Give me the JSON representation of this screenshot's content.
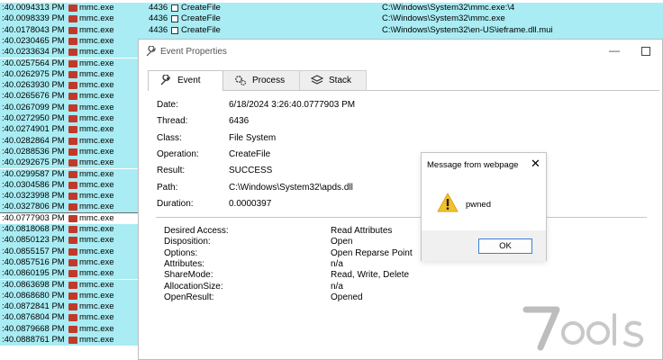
{
  "process_list": {
    "rows": [
      {
        "time": ":40.0094313 PM",
        "process": "mmc.exe",
        "pid": "4436",
        "operation": "CreateFile",
        "path": "C:\\Windows\\System32\\mmc.exe:\\4"
      },
      {
        "time": ":40.0098339 PM",
        "process": "mmc.exe",
        "pid": "4436",
        "operation": "CreateFile",
        "path": "C:\\Windows\\System32\\mmc.exe"
      },
      {
        "time": ":40.0178043 PM",
        "process": "mmc.exe",
        "pid": "4436",
        "operation": "CreateFile",
        "path": "C:\\Windows\\System32\\en-US\\ieframe.dll.mui"
      },
      {
        "time": ":40.0230465 PM",
        "process": "mmc.exe",
        "pid": "",
        "operation": "",
        "path": ""
      },
      {
        "time": ":40.0233634 PM",
        "process": "mmc.exe",
        "pid": "",
        "operation": "",
        "path": ""
      },
      {
        "time": ":40.0257564 PM",
        "process": "mmc.exe",
        "pid": "",
        "operation": "",
        "path": ""
      },
      {
        "time": ":40.0262975 PM",
        "process": "mmc.exe",
        "pid": "",
        "operation": "",
        "path": ""
      },
      {
        "time": ":40.0263930 PM",
        "process": "mmc.exe",
        "pid": "",
        "operation": "",
        "path": ""
      },
      {
        "time": ":40.0265676 PM",
        "process": "mmc.exe",
        "pid": "",
        "operation": "",
        "path": ""
      },
      {
        "time": ":40.0267099 PM",
        "process": "mmc.exe",
        "pid": "",
        "operation": "",
        "path": ""
      },
      {
        "time": ":40.0272950 PM",
        "process": "mmc.exe",
        "pid": "",
        "operation": "",
        "path": ""
      },
      {
        "time": ":40.0274901 PM",
        "process": "mmc.exe",
        "pid": "",
        "operation": "",
        "path": ""
      },
      {
        "time": ":40.0282864 PM",
        "process": "mmc.exe",
        "pid": "",
        "operation": "",
        "path": ""
      },
      {
        "time": ":40.0288536 PM",
        "process": "mmc.exe",
        "pid": "",
        "operation": "",
        "path": ""
      },
      {
        "time": ":40.0292675 PM",
        "process": "mmc.exe",
        "pid": "",
        "operation": "",
        "path": ""
      },
      {
        "time": ":40.0299587 PM",
        "process": "mmc.exe",
        "pid": "",
        "operation": "",
        "path": ""
      },
      {
        "time": ":40.0304586 PM",
        "process": "mmc.exe",
        "pid": "",
        "operation": "",
        "path": ""
      },
      {
        "time": ":40.0323998 PM",
        "process": "mmc.exe",
        "pid": "",
        "operation": "",
        "path": ""
      },
      {
        "time": ":40.0327806 PM",
        "process": "mmc.exe",
        "pid": "",
        "operation": "",
        "path": ""
      },
      {
        "time": ":40.0777903 PM",
        "process": "mmc.exe",
        "pid": "",
        "operation": "",
        "path": "",
        "selected": true
      },
      {
        "time": ":40.0818068 PM",
        "process": "mmc.exe",
        "pid": "",
        "operation": "",
        "path": ""
      },
      {
        "time": ":40.0850123 PM",
        "process": "mmc.exe",
        "pid": "",
        "operation": "",
        "path": ""
      },
      {
        "time": ":40.0855157 PM",
        "process": "mmc.exe",
        "pid": "",
        "operation": "",
        "path": ""
      },
      {
        "time": ":40.0857516 PM",
        "process": "mmc.exe",
        "pid": "",
        "operation": "",
        "path": ""
      },
      {
        "time": ":40.0860195 PM",
        "process": "mmc.exe",
        "pid": "",
        "operation": "",
        "path": ""
      },
      {
        "time": ":40.0863698 PM",
        "process": "mmc.exe",
        "pid": "",
        "operation": "",
        "path": ""
      },
      {
        "time": ":40.0868680 PM",
        "process": "mmc.exe",
        "pid": "",
        "operation": "",
        "path": ""
      },
      {
        "time": ":40.0872841 PM",
        "process": "mmc.exe",
        "pid": "",
        "operation": "",
        "path": ""
      },
      {
        "time": ":40.0876804 PM",
        "process": "mmc.exe",
        "pid": "",
        "operation": "",
        "path": ""
      },
      {
        "time": ":40.0879668 PM",
        "process": "mmc.exe",
        "pid": "",
        "operation": "",
        "path": ""
      },
      {
        "time": ":40.0888761 PM",
        "process": "mmc.exe",
        "pid": "",
        "operation": "",
        "path": ""
      }
    ],
    "colors": {
      "row_bg": "#a9ecf3",
      "selected_bg": "#ffffff",
      "process_icon": "#c0392b"
    },
    "icons": {
      "process": "mmc-process-icon",
      "operation": "file-operation-icon"
    }
  },
  "event_window": {
    "title": "Event Properties",
    "icons": {
      "title": "wrench-icon",
      "minimize": "minimize-icon",
      "maximize": "maximize-icon"
    },
    "tabs": [
      {
        "label": "Event",
        "icon": "wrench-icon",
        "active": true
      },
      {
        "label": "Process",
        "icon": "gears-icon",
        "active": false
      },
      {
        "label": "Stack",
        "icon": "stack-icon",
        "active": false
      }
    ],
    "fields": [
      {
        "label": "Date:",
        "value": "6/18/2024 3:26:40.0777903 PM"
      },
      {
        "label": "Thread:",
        "value": "6436"
      },
      {
        "label": "Class:",
        "value": "File System"
      },
      {
        "label": "Operation:",
        "value": "CreateFile"
      },
      {
        "label": "Result:",
        "value": "SUCCESS"
      },
      {
        "label": "Path:",
        "value": "C:\\Windows\\System32\\apds.dll"
      },
      {
        "label": "Duration:",
        "value": "0.0000397"
      }
    ],
    "details": [
      {
        "label": "Desired Access:",
        "value": "Read Attributes"
      },
      {
        "label": "Disposition:",
        "value": "Open"
      },
      {
        "label": "Options:",
        "value": "Open Reparse Point"
      },
      {
        "label": "Attributes:",
        "value": "n/a"
      },
      {
        "label": "ShareMode:",
        "value": "Read, Write, Delete"
      },
      {
        "label": "AllocationSize:",
        "value": "n/a"
      },
      {
        "label": "OpenResult:",
        "value": "Opened"
      }
    ]
  },
  "alert": {
    "title": "Message from webpage",
    "close_icon": "close-icon",
    "icon": "warning-icon",
    "message": "pwned",
    "ok_label": "OK",
    "colors": {
      "warning": "#f2c12e",
      "button_border": "#3c7fd8"
    }
  },
  "watermark": {
    "text": "7ools"
  }
}
